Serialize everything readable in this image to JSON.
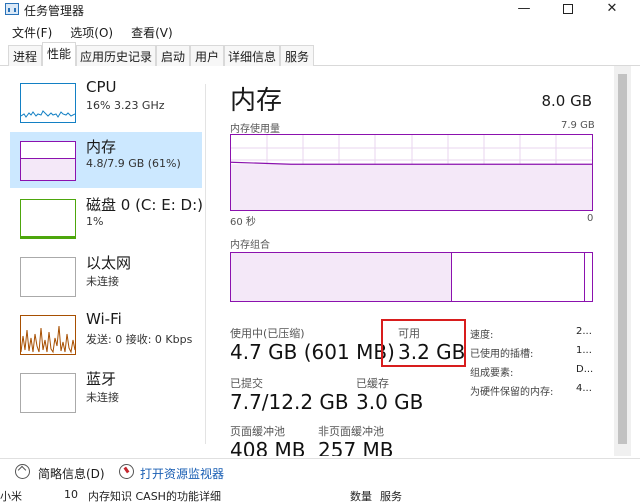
{
  "window": {
    "title": "任务管理器",
    "controls": {
      "minimize": "—",
      "close": "✕"
    }
  },
  "menu": [
    "文件(F)",
    "选项(O)",
    "查看(V)"
  ],
  "tabs": [
    "进程",
    "性能",
    "应用历史记录",
    "启动",
    "用户",
    "详细信息",
    "服务"
  ],
  "active_tab": "性能",
  "sidebar": {
    "items": [
      {
        "name": "CPU",
        "sub": "16% 3.23 GHz",
        "color": "#1380c4"
      },
      {
        "name": "内存",
        "sub": "4.8/7.9 GB (61%)",
        "color": "#8b12ae",
        "selected": true
      },
      {
        "name": "磁盘 0 (C: E: D:)",
        "sub": "1%",
        "color": "#4da60c"
      },
      {
        "name": "以太网",
        "sub": "未连接",
        "color": "#a74f01"
      },
      {
        "name": "Wi-Fi",
        "sub": "发送: 0 接收: 0 Kbps",
        "color": "#a74f01"
      },
      {
        "name": "蓝牙",
        "sub": "未连接",
        "color": "#a74f01"
      }
    ]
  },
  "memory": {
    "title": "内存",
    "total": "8.0 GB",
    "usage_label": "内存使用量",
    "usage_max": "7.9 GB",
    "time_label": "60 秒",
    "time_end": "0",
    "composition_label": "内存组合",
    "in_use_label": "使用中(已压缩)",
    "in_use_value": "4.7 GB (601 MB)",
    "available_label": "可用",
    "available_value": "3.2 GB",
    "committed_label": "已提交",
    "committed_value": "7.7/12.2 GB",
    "cached_label": "已缓存",
    "cached_value": "3.0 GB",
    "paged_label": "页面缓冲池",
    "paged_value": "408 MB",
    "nonpaged_label": "非页面缓冲池",
    "nonpaged_value": "257 MB",
    "specs": [
      {
        "label": "速度:",
        "value": "2..."
      },
      {
        "label": "已使用的插槽:",
        "value": "1..."
      },
      {
        "label": "组成要素:",
        "value": "D..."
      },
      {
        "label": "为硬件保留的内存:",
        "value": "4..."
      }
    ],
    "usage_fraction": 0.61,
    "color": "#8b12ae"
  },
  "footer": {
    "fewer_details": "简略信息(D)",
    "open_monitor": "打开资源监视器"
  },
  "background": {
    "texts": [
      "小米",
      "10",
      "内存知识 CASH的功能详细",
      "数量",
      "服务"
    ]
  }
}
